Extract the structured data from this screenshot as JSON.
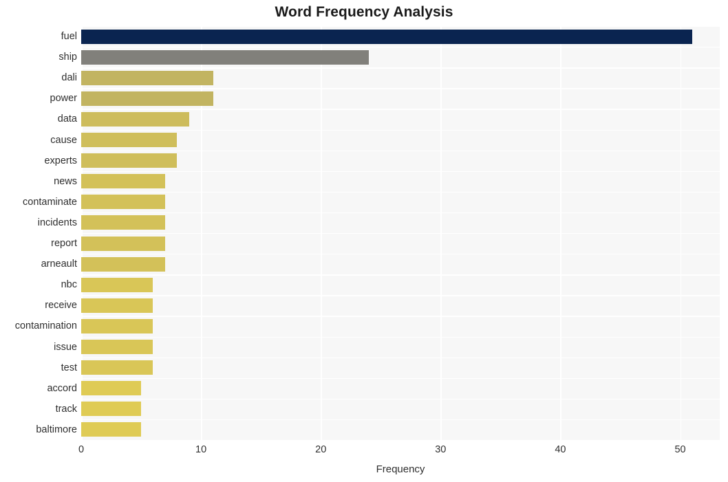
{
  "chart_data": {
    "type": "bar",
    "orientation": "horizontal",
    "title": "Word Frequency Analysis",
    "xlabel": "Frequency",
    "ylabel": "",
    "xlim": [
      0,
      53.3
    ],
    "xticks": [
      0,
      10,
      20,
      30,
      40,
      50
    ],
    "xtick_labels": [
      "0",
      "10",
      "20",
      "30",
      "40",
      "50"
    ],
    "grid": "white gridlines on light gray panel",
    "legend": "none",
    "categories": [
      "fuel",
      "ship",
      "dali",
      "power",
      "data",
      "cause",
      "experts",
      "news",
      "contaminate",
      "incidents",
      "report",
      "arneault",
      "nbc",
      "receive",
      "contamination",
      "issue",
      "test",
      "accord",
      "track",
      "baltimore"
    ],
    "values": [
      51,
      24,
      11,
      11,
      9,
      8,
      8,
      7,
      7,
      7,
      7,
      7,
      6,
      6,
      6,
      6,
      6,
      5,
      5,
      5
    ],
    "bar_colors": [
      "#0a2450",
      "#81807b",
      "#c2b461",
      "#c2b461",
      "#cdbc5c",
      "#cfbe5b",
      "#cfbe5b",
      "#d3c159",
      "#d3c159",
      "#d3c159",
      "#d3c159",
      "#d3c159",
      "#d9c657",
      "#d9c657",
      "#d9c657",
      "#d9c657",
      "#d9c657",
      "#dfcb55",
      "#dfcb55",
      "#dfcb55"
    ]
  },
  "style": {
    "panel_background": "#f7f7f7",
    "page_background": "#ffffff",
    "gridline_color": "#ffffff",
    "text_color": "#2e2e2e",
    "title_color": "#1a1a1a"
  }
}
